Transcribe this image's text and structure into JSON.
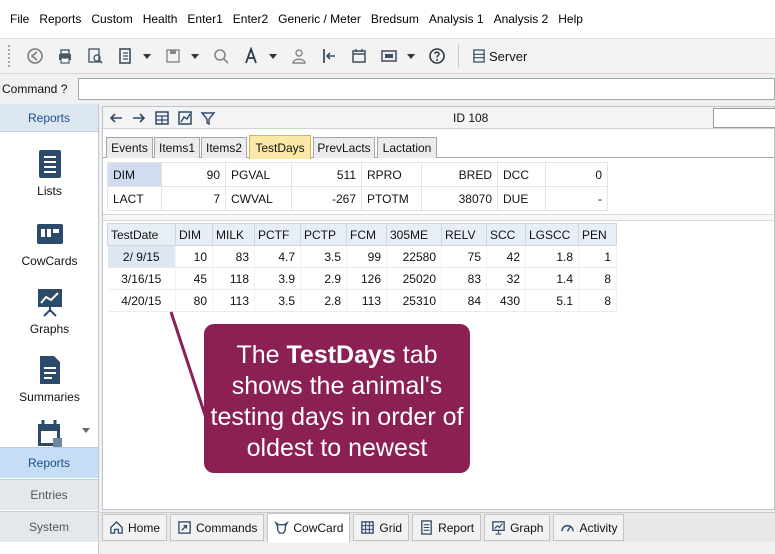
{
  "menu": [
    "File",
    "Reports",
    "Custom",
    "Health",
    "Enter1",
    "Enter2",
    "Generic / Meter",
    "Bredsum",
    "Analysis 1",
    "Analysis 2",
    "Help"
  ],
  "toolbar": {
    "buttons": [
      "back-icon",
      "print-icon",
      "print-preview-icon",
      "book-icon",
      "save-icon",
      "search-icon",
      "font-icon",
      "person-icon",
      "import-icon",
      "calendar-icon",
      "screen-icon",
      "help-icon"
    ],
    "server_label": "Server"
  },
  "command": {
    "label": "Command ?",
    "value": ""
  },
  "sidebar": {
    "header": "Reports",
    "items": [
      {
        "icon": "lists-icon",
        "label": "Lists"
      },
      {
        "icon": "cowcards-icon",
        "label": "CowCards"
      },
      {
        "icon": "graphs-icon",
        "label": "Graphs"
      },
      {
        "icon": "summaries-icon",
        "label": "Summaries"
      },
      {
        "icon": "calendar-report-icon",
        "label": ""
      }
    ],
    "bottom_tabs": [
      "Reports",
      "Entries",
      "System"
    ],
    "active_tab": "Reports"
  },
  "cowcard": {
    "id_label": "ID 108",
    "tabs": [
      "Events",
      "Items1",
      "Items2",
      "TestDays",
      "PrevLacts",
      "Lactation"
    ],
    "active_tab": "TestDays",
    "info": [
      [
        {
          "label": "DIM",
          "value": "90"
        },
        {
          "label": "PGVAL",
          "value": "511"
        },
        {
          "label": "RPRO",
          "value": "BRED"
        },
        {
          "label": "DCC",
          "value": "0"
        }
      ],
      [
        {
          "label": "LACT",
          "value": "7"
        },
        {
          "label": "CWVAL",
          "value": "-267"
        },
        {
          "label": "PTOTM",
          "value": "38070"
        },
        {
          "label": "DUE",
          "value": "-"
        }
      ]
    ],
    "testdays": {
      "columns": [
        "TestDate",
        "DIM",
        "MILK",
        "PCTF",
        "PCTP",
        "FCM",
        "305ME",
        "RELV",
        "SCC",
        "LGSCC",
        "PEN"
      ],
      "rows": [
        [
          "2/ 9/15",
          "10",
          "83",
          "4.7",
          "3.5",
          "99",
          "22580",
          "75",
          "42",
          "1.8",
          "1"
        ],
        [
          "3/16/15",
          "45",
          "118",
          "3.9",
          "2.9",
          "126",
          "25020",
          "83",
          "32",
          "1.4",
          "8"
        ],
        [
          "4/20/15",
          "80",
          "113",
          "3.5",
          "2.8",
          "113",
          "25310",
          "84",
          "430",
          "5.1",
          "8"
        ]
      ]
    }
  },
  "callout": {
    "pre": "The ",
    "bold": "TestDays",
    "post": " tab shows the animal's testing days in order of oldest to newest",
    "color": "#8a2054"
  },
  "bottom_tabs": [
    {
      "icon": "home-icon",
      "label": "Home"
    },
    {
      "icon": "commands-icon",
      "label": "Commands"
    },
    {
      "icon": "cow-icon",
      "label": "CowCard"
    },
    {
      "icon": "grid-icon",
      "label": "Grid"
    },
    {
      "icon": "report-icon",
      "label": "Report"
    },
    {
      "icon": "graph-icon",
      "label": "Graph"
    },
    {
      "icon": "activity-icon",
      "label": "Activity"
    }
  ],
  "bottom_active": "CowCard"
}
